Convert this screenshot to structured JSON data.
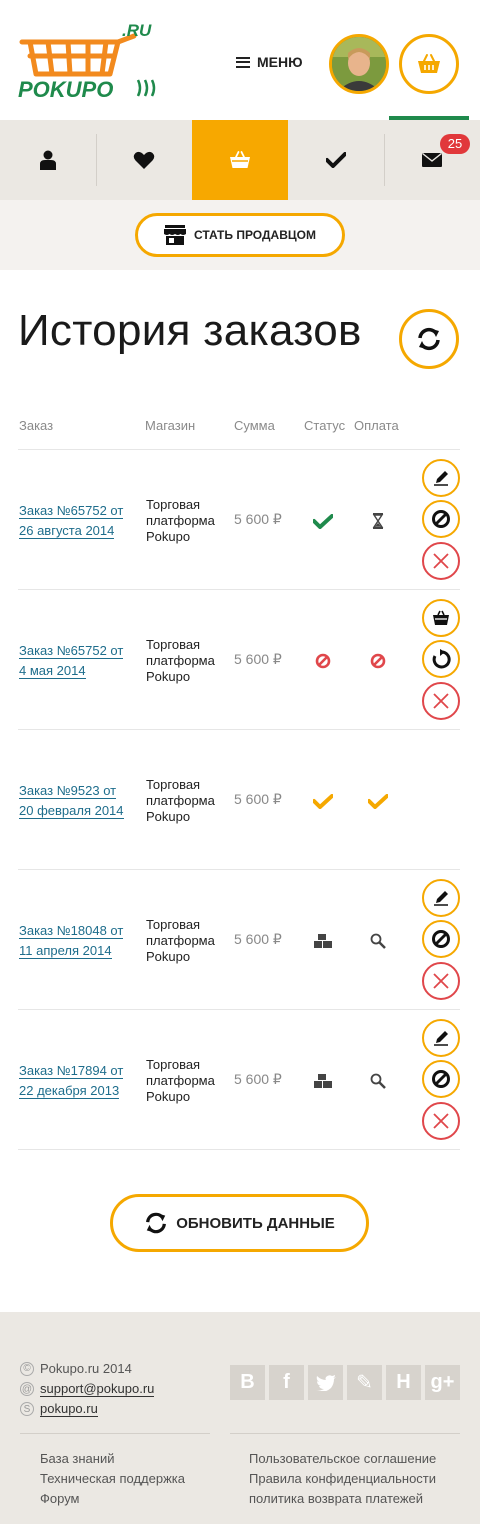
{
  "header": {
    "logo_text": "POKUPO",
    "logo_suffix": ".RU",
    "menu_label": "МЕНЮ"
  },
  "tabs": {
    "items": [
      {
        "name": "profile",
        "icon": "user-icon"
      },
      {
        "name": "favorites",
        "icon": "heart-icon"
      },
      {
        "name": "orders",
        "icon": "basket-icon",
        "active": true
      },
      {
        "name": "completed",
        "icon": "check-icon"
      },
      {
        "name": "messages",
        "icon": "envelope-icon"
      }
    ],
    "messages_badge": "25"
  },
  "seller": {
    "label": "СТАТЬ ПРОДАВЦОМ"
  },
  "page": {
    "title": "История заказов"
  },
  "table": {
    "headers": {
      "order": "Заказ",
      "shop": "Магазин",
      "sum": "Сумма",
      "status": "Статус",
      "payment": "Оплата"
    },
    "rows": [
      {
        "order": "Заказ №65752 от 26 августа 2014",
        "shop": "Торговая платформа Pokupo",
        "sum": "5 600 ₽",
        "status": "check-green-icon",
        "payment": "hourglass-icon",
        "actions": [
          "edit-icon",
          "cancel-icon",
          "delete-icon"
        ]
      },
      {
        "order": "Заказ №65752 от 4 мая 2014",
        "shop": "Торговая платформа Pokupo",
        "sum": "5 600 ₽",
        "status": "ban-red-icon",
        "payment": "ban-red-icon",
        "actions": [
          "basket-icon",
          "repeat-icon",
          "delete-icon"
        ]
      },
      {
        "order": "Заказ №9523 от 20 февраля 2014",
        "shop": "Торговая платформа Pokupo",
        "sum": "5 600 ₽",
        "status": "check-orange-icon",
        "payment": "check-orange-icon",
        "actions": []
      },
      {
        "order": "Заказ №18048 от 11 апреля 2014",
        "shop": "Торговая платформа Pokupo",
        "sum": "5 600 ₽",
        "status": "boxes-icon",
        "payment": "magnifier-icon",
        "actions": [
          "edit-icon",
          "cancel-icon",
          "delete-icon"
        ]
      },
      {
        "order": "Заказ №17894 от 22 декабря 2013",
        "shop": "Торговая платформа Pokupo",
        "sum": "5 600 ₽",
        "status": "boxes-icon",
        "payment": "magnifier-icon",
        "actions": [
          "edit-icon",
          "cancel-icon",
          "delete-icon"
        ]
      }
    ]
  },
  "update": {
    "label": "ОБНОВИТЬ ДАННЫЕ"
  },
  "footer": {
    "copyright": "Pokupo.ru 2014",
    "email": "support@pokupo.ru",
    "skype": "pokupo.ru",
    "socials": [
      "В",
      "f",
      "t",
      "✎",
      "Н",
      "g+"
    ],
    "links_left": [
      "База знаний",
      "Техническая поддержка",
      "Форум"
    ],
    "links_right": [
      "Пользовательское соглашение",
      "Правила конфиденциальности",
      "политика возврата платежей"
    ]
  },
  "colors": {
    "accent": "#f5a800",
    "green": "#1f8a4c",
    "red": "#e0474b",
    "link": "#1e6d8c"
  }
}
